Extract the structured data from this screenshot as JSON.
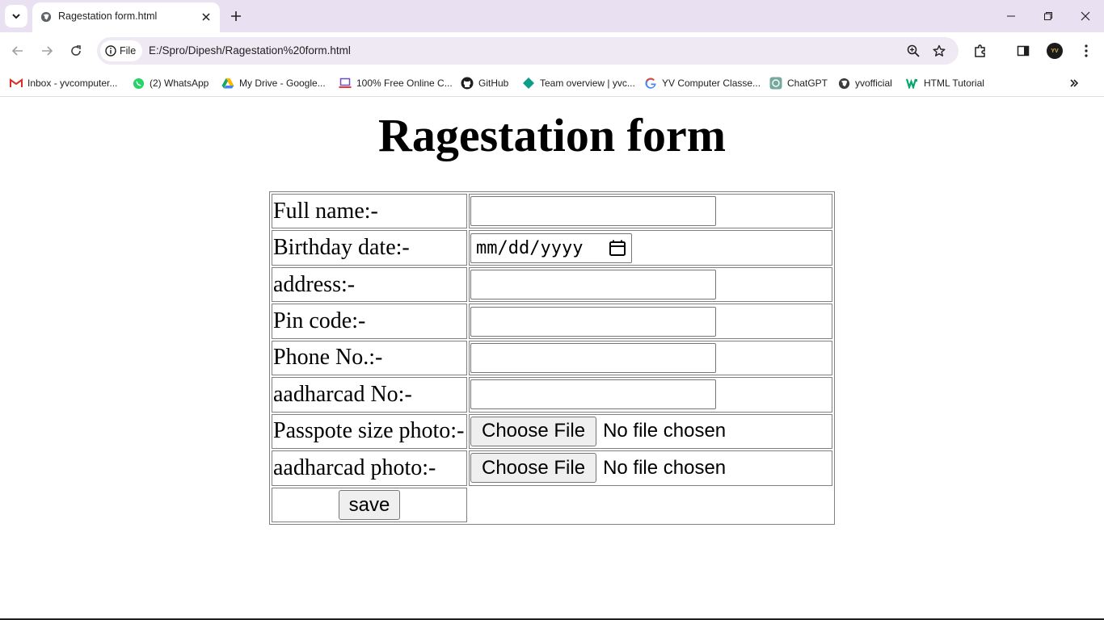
{
  "browser": {
    "tab": {
      "title": "Ragestation form.html"
    },
    "omnibox": {
      "site_label": "File",
      "url": "E:/Spro/Dipesh/Ragestation%20form.html"
    },
    "profile_initials": "YV",
    "bookmarks": [
      {
        "label": "Inbox - yvcomputer...",
        "icon": "gmail-icon",
        "color": "#d93025"
      },
      {
        "label": "(2) WhatsApp",
        "icon": "whatsapp-icon",
        "color": "#25d366"
      },
      {
        "label": "My Drive - Google...",
        "icon": "google-drive-icon",
        "color": "#1fa463"
      },
      {
        "label": "100% Free Online C...",
        "icon": "laptop-icon",
        "color": "#6b4fbb"
      },
      {
        "label": "GitHub",
        "icon": "github-icon",
        "color": "#1f1f1f"
      },
      {
        "label": "Team overview | yvc...",
        "icon": "diamond-icon",
        "color": "#0f9d8a"
      },
      {
        "label": "YV Computer Classe...",
        "icon": "google-icon",
        "color": "#4285f4"
      },
      {
        "label": "ChatGPT",
        "icon": "chatgpt-icon",
        "color": "#74aa9c"
      },
      {
        "label": "yvofficial",
        "icon": "globe-icon",
        "color": "#333333"
      },
      {
        "label": "HTML Tutorial",
        "icon": "w3schools-icon",
        "color": "#04aa6d"
      }
    ]
  },
  "page": {
    "title": "Ragestation form",
    "fields": [
      {
        "label": "Full name:-",
        "type": "text",
        "value": ""
      },
      {
        "label": "Birthday date:-",
        "type": "date",
        "placeholder": "mm/dd/yyyy"
      },
      {
        "label": "address:-",
        "type": "text",
        "value": ""
      },
      {
        "label": "Pin code:-",
        "type": "text",
        "value": ""
      },
      {
        "label": "Phone No.:-",
        "type": "text",
        "value": ""
      },
      {
        "label": "aadharcad No:-",
        "type": "text",
        "value": ""
      },
      {
        "label": "Passpote size photo:-",
        "type": "file",
        "button": "Choose File",
        "status": "No file chosen"
      },
      {
        "label": "aadharcad photo:-",
        "type": "file",
        "button": "Choose File",
        "status": "No file chosen"
      }
    ],
    "save_label": "save"
  }
}
